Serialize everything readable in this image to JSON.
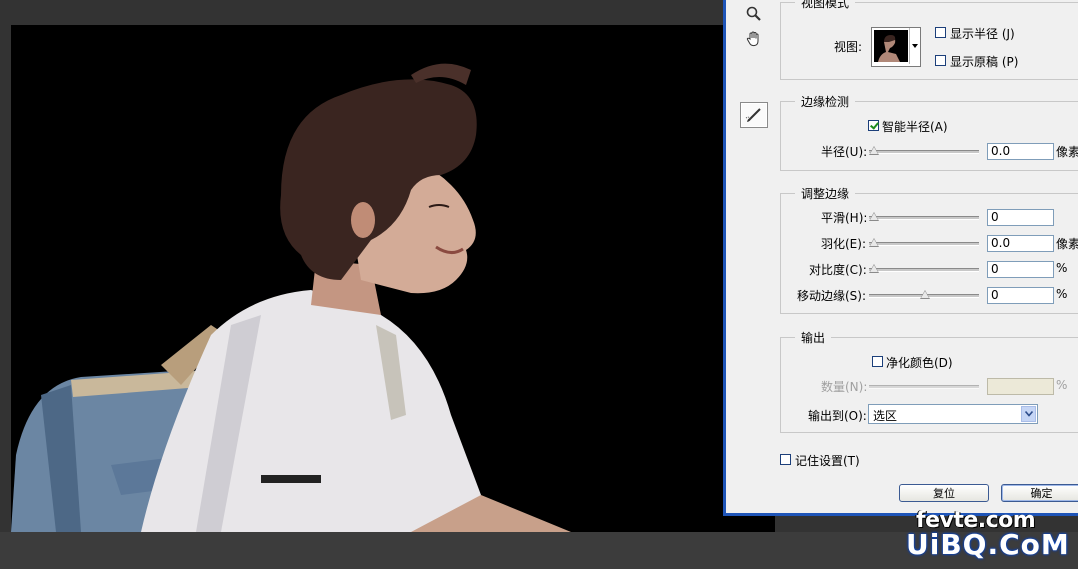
{
  "dialog": {
    "view_mode": {
      "legend": "视图模式",
      "view_label": "视图:",
      "show_radius": "显示半径 (J)",
      "show_original": "显示原稿 (P)"
    },
    "edge_detection": {
      "legend": "边缘检测",
      "smart_radius": "智能半径(A)",
      "radius_label": "半径(U):",
      "radius_value": "0.0",
      "radius_unit": "像素"
    },
    "adjust_edge": {
      "legend": "调整边缘",
      "smooth_label": "平滑(H):",
      "smooth_value": "0",
      "feather_label": "羽化(E):",
      "feather_value": "0.0",
      "feather_unit": "像素",
      "contrast_label": "对比度(C):",
      "contrast_value": "0",
      "contrast_unit": "%",
      "shift_edge_label": "移动边缘(S):",
      "shift_edge_value": "0",
      "shift_edge_unit": "%"
    },
    "output": {
      "legend": "输出",
      "decontaminate": "净化颜色(D)",
      "amount_label": "数量(N):",
      "amount_unit": "%",
      "output_to_label": "输出到(O):",
      "output_to_value": "选区"
    },
    "remember": "记住设置(T)",
    "reset_button": "复位",
    "ok_button": "确定"
  },
  "watermark": {
    "line1": "fevte.com",
    "line2": "UiBQ.CoM"
  },
  "icons": {
    "zoom": "zoom-icon",
    "hand": "hand-icon",
    "refine_brush": "refine-radius-brush-icon"
  }
}
